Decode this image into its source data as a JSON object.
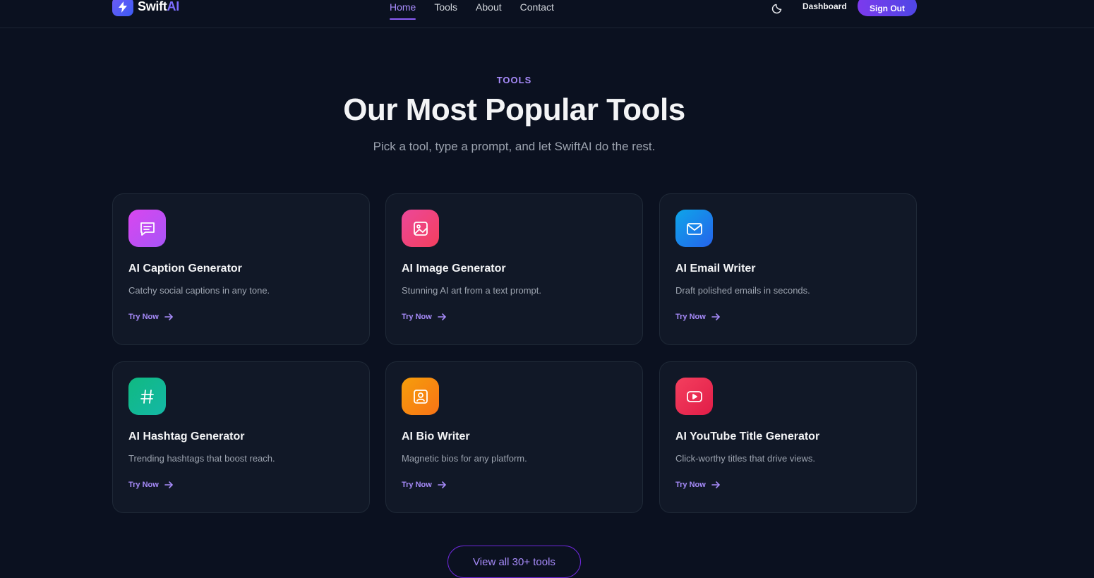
{
  "brand": {
    "name_part1": "Swift",
    "name_part2": "AI"
  },
  "nav": [
    {
      "label": "Home",
      "active": true
    },
    {
      "label": "Tools",
      "active": false
    },
    {
      "label": "About",
      "active": false
    },
    {
      "label": "Contact",
      "active": false
    }
  ],
  "header": {
    "dashboard_label": "Dashboard",
    "signout_label": "Sign Out",
    "theme_icon": "moon-icon"
  },
  "section": {
    "eyebrow": "TOOLS",
    "title": "Our Most Popular Tools",
    "subtitle": "Pick a tool, type a prompt, and let SwiftAI do the rest."
  },
  "tools": [
    {
      "title": "AI Caption Generator",
      "desc": "Catchy social captions in any tone.",
      "cta": "Try Now",
      "icon": "chat-icon",
      "color_from": "#d946ef",
      "color_to": "#a855f7"
    },
    {
      "title": "AI Image Generator",
      "desc": "Stunning AI art from a text prompt.",
      "cta": "Try Now",
      "icon": "image-icon",
      "color_from": "#ec4899",
      "color_to": "#f43f5e"
    },
    {
      "title": "AI Email Writer",
      "desc": "Draft polished emails in seconds.",
      "cta": "Try Now",
      "icon": "mail-icon",
      "color_from": "#0ea5e9",
      "color_to": "#2563eb"
    },
    {
      "title": "AI Hashtag Generator",
      "desc": "Trending hashtags that boost reach.",
      "cta": "Try Now",
      "icon": "hash-icon",
      "color_from": "#10b981",
      "color_to": "#14b8a6"
    },
    {
      "title": "AI Bio Writer",
      "desc": "Magnetic bios for any platform.",
      "cta": "Try Now",
      "icon": "user-card-icon",
      "color_from": "#f59e0b",
      "color_to": "#f97316"
    },
    {
      "title": "AI YouTube Title Generator",
      "desc": "Click-worthy titles that drive views.",
      "cta": "Try Now",
      "icon": "youtube-icon",
      "color_from": "#f43f5e",
      "color_to": "#e11d48"
    }
  ],
  "view_all_label": "View all 30+ tools"
}
